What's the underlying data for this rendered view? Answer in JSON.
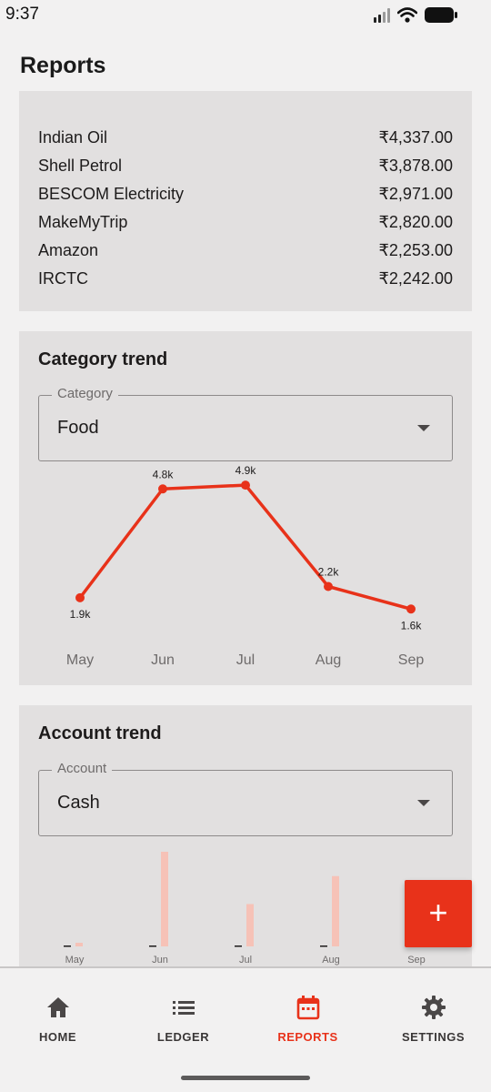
{
  "status_bar": {
    "time": "9:37"
  },
  "header": {
    "title": "Reports"
  },
  "top_merchants": {
    "rows": [
      {
        "name": "Indian Oil",
        "amount": "₹4,337.00"
      },
      {
        "name": "Shell Petrol",
        "amount": "₹3,878.00"
      },
      {
        "name": "BESCOM Electricity",
        "amount": "₹2,971.00"
      },
      {
        "name": "MakeMyTrip",
        "amount": "₹2,820.00"
      },
      {
        "name": "Amazon",
        "amount": "₹2,253.00"
      },
      {
        "name": "IRCTC",
        "amount": "₹2,242.00"
      }
    ]
  },
  "category_trend": {
    "title": "Category trend",
    "select_label": "Category",
    "select_value": "Food"
  },
  "account_trend": {
    "title": "Account trend",
    "select_label": "Account",
    "select_value": "Cash"
  },
  "chart_data": [
    {
      "type": "line",
      "title": "Category trend",
      "categories": [
        "May",
        "Jun",
        "Jul",
        "Aug",
        "Sep"
      ],
      "values": [
        1.9,
        4.8,
        4.9,
        2.2,
        1.6
      ],
      "value_labels": [
        "1.9k",
        "4.8k",
        "4.9k",
        "2.2k",
        "1.6k"
      ],
      "unit": "thousands",
      "color": "#e8321a",
      "grid": false
    },
    {
      "type": "bar",
      "title": "Account trend",
      "categories": [
        "May",
        "Jun",
        "Jul",
        "Aug",
        "Sep"
      ],
      "series": [
        {
          "values": [
            0,
            0,
            0,
            0,
            0
          ],
          "color": "#1d1b1b"
        },
        {
          "values": [
            0.4,
            10.5,
            4.7,
            7.8,
            0
          ],
          "color": "#f6c2b7"
        }
      ],
      "grid": false
    }
  ],
  "fab": {
    "label": "+"
  },
  "bottom_nav": {
    "items": [
      {
        "label": "HOME",
        "icon": "home-icon",
        "active": false
      },
      {
        "label": "LEDGER",
        "icon": "list-icon",
        "active": false
      },
      {
        "label": "REPORTS",
        "icon": "calendar-icon",
        "active": true
      },
      {
        "label": "SETTINGS",
        "icon": "gear-icon",
        "active": false
      }
    ]
  },
  "colors": {
    "accent": "#e8321a",
    "card": "#e2e0e0",
    "background": "#f2f1f1"
  }
}
